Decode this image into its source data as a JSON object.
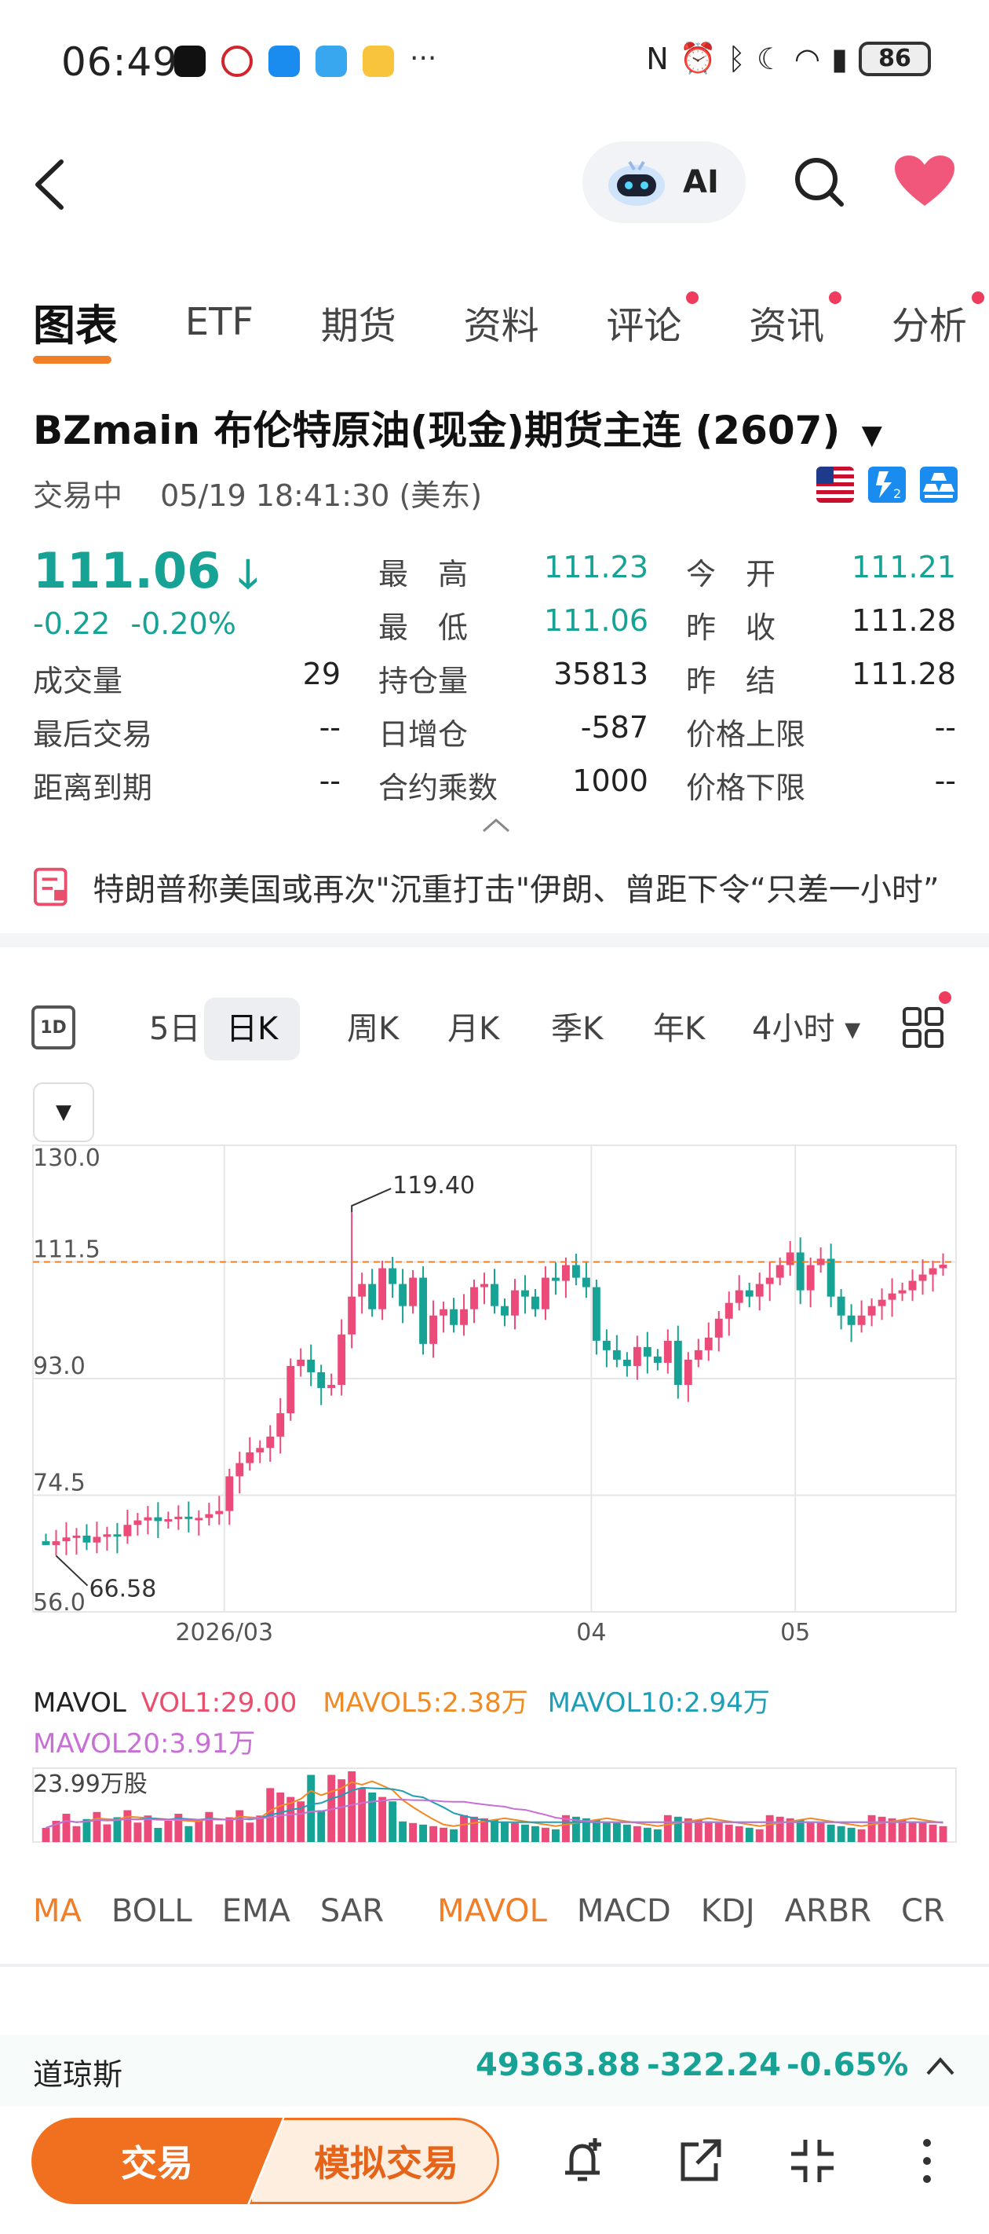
{
  "status": {
    "time": "06:49",
    "battery": "86"
  },
  "header": {
    "ai_label": "AI"
  },
  "tabs": [
    {
      "label": "图表",
      "active": true,
      "dot": false
    },
    {
      "label": "ETF",
      "active": false,
      "dot": false
    },
    {
      "label": "期货",
      "active": false,
      "dot": false
    },
    {
      "label": "资料",
      "active": false,
      "dot": false
    },
    {
      "label": "评论",
      "active": false,
      "dot": true
    },
    {
      "label": "资讯",
      "active": false,
      "dot": true
    },
    {
      "label": "分析",
      "active": false,
      "dot": true
    }
  ],
  "instrument": {
    "title": "BZmain  布伦特原油(现金)期货主连 (2607)",
    "status": "交易中",
    "datetime": "05/19 18:41:30 (美东)"
  },
  "quote": {
    "price": "111.06",
    "change": "-0.22",
    "change_pct": "-0.20%",
    "fields": {
      "high_label": "最　高",
      "high": "111.23",
      "open_label": "今　开",
      "open": "111.21",
      "low_label": "最　低",
      "low": "111.06",
      "prev_close_label": "昨　收",
      "prev_close": "111.28",
      "volume_label": "成交量",
      "volume": "29",
      "oi_label": "持仓量",
      "oi": "35813",
      "prev_settle_label": "昨　结",
      "prev_settle": "111.28",
      "last_trade_label": "最后交易",
      "last_trade": "--",
      "oi_change_label": "日增仓",
      "oi_change": "-587",
      "limit_up_label": "价格上限",
      "limit_up": "--",
      "expiry_label": "距离到期",
      "expiry": "--",
      "multiplier_label": "合约乘数",
      "multiplier": "1000",
      "limit_down_label": "价格下限",
      "limit_down": "--"
    }
  },
  "news": {
    "headline": "特朗普称美国或再次\"沉重打击\"伊朗、曾距下令“只差一小时”"
  },
  "periods": [
    {
      "label": "5日",
      "active": false
    },
    {
      "label": "日K",
      "active": true
    },
    {
      "label": "周K",
      "active": false
    },
    {
      "label": "月K",
      "active": false
    },
    {
      "label": "季K",
      "active": false
    },
    {
      "label": "年K",
      "active": false
    },
    {
      "label": "4小时",
      "active": false
    }
  ],
  "period_icon_label": "1D",
  "chart_data": {
    "type": "candlestick",
    "y_ticks": [
      "130.0",
      "111.5",
      "93.0",
      "74.5",
      "56.0"
    ],
    "ylim": [
      56.0,
      130.0
    ],
    "x_ticks": [
      "2026/03",
      "04",
      "05"
    ],
    "high_annotation": "119.40",
    "low_annotation": "66.58",
    "current_line": 111.5,
    "closes": [
      66.6,
      67.2,
      67.8,
      68.1,
      67.0,
      67.9,
      68.3,
      68.0,
      69.8,
      70.5,
      71.0,
      70.4,
      70.7,
      71.1,
      70.8,
      70.9,
      71.5,
      72.0,
      77.5,
      79.6,
      81.3,
      82.0,
      83.8,
      87.5,
      95.0,
      96.0,
      94.0,
      91.5,
      92.0,
      100.0,
      106.0,
      108.0,
      104.0,
      110.5,
      108.0,
      104.5,
      109.0,
      98.5,
      103.0,
      104.0,
      101.5,
      104.0,
      107.5,
      108.0,
      104.5,
      103.0,
      107.0,
      106.0,
      104.0,
      109.0,
      108.5,
      111.0,
      109.0,
      107.5,
      99.0,
      97.5,
      96.0,
      95.0,
      98.0,
      96.5,
      95.5,
      99.0,
      92.0,
      96.0,
      97.5,
      99.5,
      102.5,
      105.0,
      107.0,
      106.0,
      108.0,
      109.0,
      111.0,
      113.0,
      107.0,
      111.0,
      112.0,
      106.0,
      103.0,
      101.5,
      103.0,
      104.5,
      105.5,
      106.5,
      107.0,
      108.5,
      109.5,
      110.5,
      111.06
    ],
    "volume_max_label": "23.99万股",
    "mavol": {
      "title": "MAVOL",
      "vol1": "VOL1:29.00",
      "ma5": "MAVOL5:2.38万",
      "ma10": "MAVOL10:2.94万",
      "ma20": "MAVOL20:3.91万"
    }
  },
  "indicators": [
    {
      "label": "MA",
      "active": true
    },
    {
      "label": "BOLL",
      "active": false
    },
    {
      "label": "EMA",
      "active": false
    },
    {
      "label": "SAR",
      "active": false
    },
    {
      "label": "MAVOL",
      "active": true
    },
    {
      "label": "MACD",
      "active": false
    },
    {
      "label": "KDJ",
      "active": false
    },
    {
      "label": "ARBR",
      "active": false
    },
    {
      "label": "CR",
      "active": false
    }
  ],
  "ticker": {
    "name": "道琼斯",
    "value": "49363.88",
    "change": "-322.24",
    "pct": "-0.65%"
  },
  "bottom": {
    "trade": "交易",
    "sim_trade": "模拟交易"
  },
  "colors": {
    "up": "#ec4a78",
    "down": "#16a294",
    "accent": "#f07f28"
  }
}
